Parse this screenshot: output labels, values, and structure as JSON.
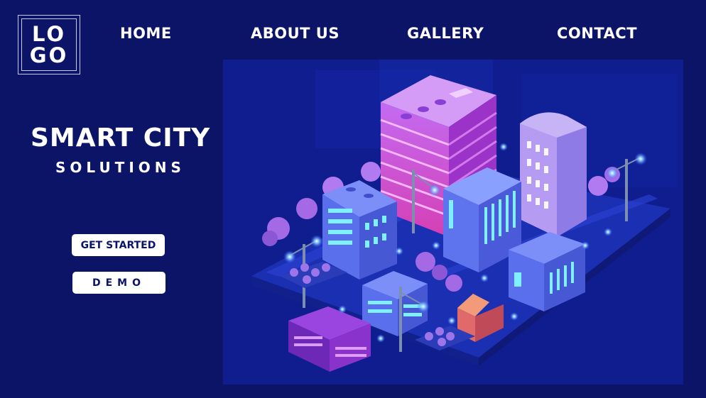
{
  "logo": {
    "line1": "LO",
    "line2": "GO"
  },
  "nav": {
    "home": "HOME",
    "about": "ABOUT US",
    "gallery": "GALLERY",
    "contact": "CONTACT"
  },
  "hero": {
    "title": "SMART CITY",
    "subtitle": "SOLUTIONS"
  },
  "buttons": {
    "get_started": "GET STARTED",
    "demo": "DEMO"
  },
  "colors": {
    "background": "#0b1466",
    "button_bg": "#ffffff",
    "button_text": "#0b1466",
    "accent_purple": "#9b45e0",
    "accent_cyan": "#5fe6ff"
  }
}
